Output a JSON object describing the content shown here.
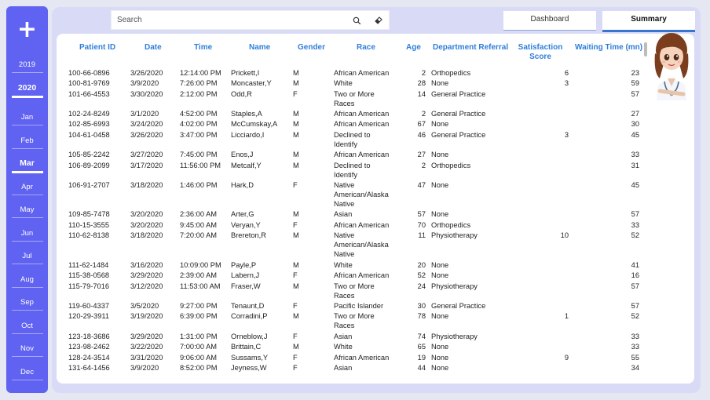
{
  "sidebar": {
    "add_symbol": "+",
    "years": [
      "2019",
      "2020"
    ],
    "months": [
      "Jan",
      "Feb",
      "Mar",
      "Apr",
      "May",
      "Jun",
      "Jul",
      "Aug",
      "Sep",
      "Oct",
      "Nov",
      "Dec"
    ],
    "selected_year": "2020",
    "selected_month": "Mar"
  },
  "search": {
    "placeholder": "Search"
  },
  "tabs": {
    "dashboard": "Dashboard",
    "summary": "Summary"
  },
  "table": {
    "headers": {
      "patient_id": "Patient ID",
      "date": "Date",
      "time": "Time",
      "name": "Name",
      "gender": "Gender",
      "race": "Race",
      "age": "Age",
      "department": "Department Referral",
      "satisfaction_1": "Satisfaction",
      "satisfaction_2": "Score",
      "waiting": "Waiting Time (mn)"
    },
    "rows": [
      {
        "id": "100-66-0896",
        "date": "3/26/2020",
        "time": "12:14:00 PM",
        "name": "Prickett,I",
        "gender": "M",
        "race": [
          "African American"
        ],
        "age": "2",
        "dept": "Orthopedics",
        "sat": "6",
        "wait": "23"
      },
      {
        "id": "100-81-9769",
        "date": "3/9/2020",
        "time": "7:26:00 PM",
        "name": "Moncaster,Y",
        "gender": "M",
        "race": [
          "White"
        ],
        "age": "28",
        "dept": "None",
        "sat": "3",
        "wait": "59"
      },
      {
        "id": "101-66-4553",
        "date": "3/30/2020",
        "time": "2:12:00 PM",
        "name": "Odd,R",
        "gender": "F",
        "race": [
          "Two or More",
          "Races"
        ],
        "age": "14",
        "dept": "General Practice",
        "sat": "",
        "wait": "57"
      },
      {
        "id": "102-24-8249",
        "date": "3/1/2020",
        "time": "4:52:00 PM",
        "name": "Staples,A",
        "gender": "M",
        "race": [
          "African American"
        ],
        "age": "2",
        "dept": "General Practice",
        "sat": "",
        "wait": "27"
      },
      {
        "id": "102-85-6993",
        "date": "3/24/2020",
        "time": "4:02:00 PM",
        "name": "McCumskay,A",
        "gender": "M",
        "race": [
          "African American"
        ],
        "age": "67",
        "dept": "None",
        "sat": "",
        "wait": "30"
      },
      {
        "id": "104-61-0458",
        "date": "3/26/2020",
        "time": "3:47:00 PM",
        "name": "Licciardo,I",
        "gender": "M",
        "race": [
          "Declined to",
          "Identify"
        ],
        "age": "46",
        "dept": "General Practice",
        "sat": "3",
        "wait": "45"
      },
      {
        "id": "105-85-2242",
        "date": "3/27/2020",
        "time": "7:45:00 PM",
        "name": "Enos,J",
        "gender": "M",
        "race": [
          "African American"
        ],
        "age": "27",
        "dept": "None",
        "sat": "",
        "wait": "33"
      },
      {
        "id": "106-89-2099",
        "date": "3/17/2020",
        "time": "11:56:00 PM",
        "name": "Metcalf,Y",
        "gender": "M",
        "race": [
          "Declined to",
          "Identify"
        ],
        "age": "2",
        "dept": "Orthopedics",
        "sat": "",
        "wait": "31"
      },
      {
        "id": "106-91-2707",
        "date": "3/18/2020",
        "time": "1:46:00 PM",
        "name": "Hark,D",
        "gender": "F",
        "race": [
          "Native",
          "American/Alaska",
          "Native"
        ],
        "age": "47",
        "dept": "None",
        "sat": "",
        "wait": "45"
      },
      {
        "id": "109-85-7478",
        "date": "3/20/2020",
        "time": "2:36:00 AM",
        "name": "Arter,G",
        "gender": "M",
        "race": [
          "Asian"
        ],
        "age": "57",
        "dept": "None",
        "sat": "",
        "wait": "57"
      },
      {
        "id": "110-15-3555",
        "date": "3/20/2020",
        "time": "9:45:00 AM",
        "name": "Veryan,Y",
        "gender": "F",
        "race": [
          "African American"
        ],
        "age": "70",
        "dept": "Orthopedics",
        "sat": "",
        "wait": "33"
      },
      {
        "id": "110-62-8138",
        "date": "3/18/2020",
        "time": "7:20:00 AM",
        "name": "Brereton,R",
        "gender": "M",
        "race": [
          "Native",
          "American/Alaska",
          "Native"
        ],
        "age": "11",
        "dept": "Physiotherapy",
        "sat": "10",
        "wait": "52"
      },
      {
        "id": "111-62-1484",
        "date": "3/16/2020",
        "time": "10:09:00 PM",
        "name": "Payle,P",
        "gender": "M",
        "race": [
          "White"
        ],
        "age": "20",
        "dept": "None",
        "sat": "",
        "wait": "41"
      },
      {
        "id": "115-38-0568",
        "date": "3/29/2020",
        "time": "2:39:00 AM",
        "name": "Labern,J",
        "gender": "F",
        "race": [
          "African American"
        ],
        "age": "52",
        "dept": "None",
        "sat": "",
        "wait": "16"
      },
      {
        "id": "115-79-7016",
        "date": "3/12/2020",
        "time": "11:53:00 AM",
        "name": "Fraser,W",
        "gender": "M",
        "race": [
          "Two or More",
          "Races"
        ],
        "age": "24",
        "dept": "Physiotherapy",
        "sat": "",
        "wait": "57"
      },
      {
        "id": "119-60-4337",
        "date": "3/5/2020",
        "time": "9:27:00 PM",
        "name": "Tenaunt,D",
        "gender": "F",
        "race": [
          "Pacific Islander"
        ],
        "age": "30",
        "dept": "General Practice",
        "sat": "",
        "wait": "57"
      },
      {
        "id": "120-29-3911",
        "date": "3/19/2020",
        "time": "6:39:00 PM",
        "name": "Corradini,P",
        "gender": "M",
        "race": [
          "Two or More",
          "Races"
        ],
        "age": "78",
        "dept": "None",
        "sat": "1",
        "wait": "52"
      },
      {
        "id": "123-18-3686",
        "date": "3/29/2020",
        "time": "1:31:00 PM",
        "name": "Orneblow,J",
        "gender": "F",
        "race": [
          "Asian"
        ],
        "age": "74",
        "dept": "Physiotherapy",
        "sat": "",
        "wait": "33"
      },
      {
        "id": "123-98-2462",
        "date": "3/22/2020",
        "time": "7:00:00 AM",
        "name": "Brittain,C",
        "gender": "M",
        "race": [
          "White"
        ],
        "age": "65",
        "dept": "None",
        "sat": "",
        "wait": "33"
      },
      {
        "id": "128-24-3514",
        "date": "3/31/2020",
        "time": "9:06:00 AM",
        "name": "Sussams,Y",
        "gender": "F",
        "race": [
          "African American"
        ],
        "age": "19",
        "dept": "None",
        "sat": "9",
        "wait": "55"
      },
      {
        "id": "131-64-1456",
        "date": "3/9/2020",
        "time": "8:52:00 PM",
        "name": "Jeyness,W",
        "gender": "F",
        "race": [
          "Asian"
        ],
        "age": "44",
        "dept": "None",
        "sat": "",
        "wait": "34"
      }
    ]
  },
  "colors": {
    "sidebar": "#6062f1",
    "header_text": "#2f7ed8",
    "panel": "#d9dbf6",
    "background": "#e5e7f3",
    "tab_active_underline": "#3a74d1"
  },
  "icons": {
    "search": "search-icon",
    "eraser": "eraser-icon",
    "add": "plus-icon",
    "avatar": "nurse-avatar-icon"
  }
}
